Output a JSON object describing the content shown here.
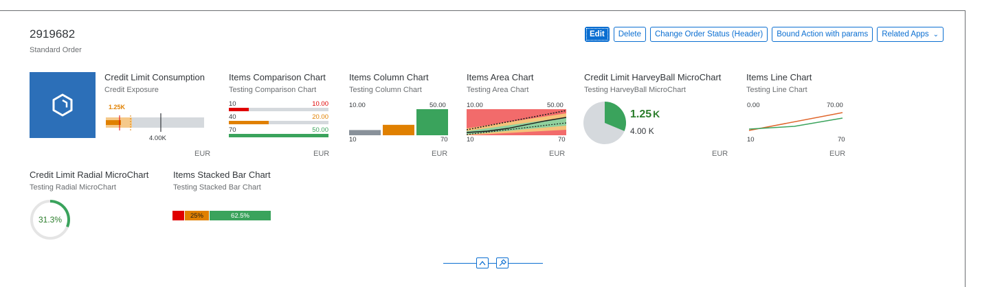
{
  "header": {
    "title": "2919682",
    "subtitle": "Standard Order",
    "actions": {
      "edit": "Edit",
      "delete": "Delete",
      "change_status": "Change Order Status (Header)",
      "bound_action": "Bound Action with params",
      "related_apps": "Related Apps"
    }
  },
  "cards": {
    "credit_limit": {
      "title": "Credit Limit Consumption",
      "subtitle": "Credit Exposure",
      "value_label": "1.25K",
      "target_label": "4.00K",
      "unit": "EUR",
      "chart_data": {
        "type": "bar",
        "actual": 1.25,
        "target": 4.0,
        "max": 10.0
      }
    },
    "comparison": {
      "title": "Items Comparison Chart",
      "subtitle": "Testing Comparison Chart",
      "unit": "EUR",
      "rows": [
        {
          "label": "10",
          "value": "10.00",
          "color": "#e00000",
          "fraction": 0.2
        },
        {
          "label": "40",
          "value": "20.00",
          "color": "#e08000",
          "fraction": 0.4
        },
        {
          "label": "70",
          "value": "50.00",
          "color": "#3aa35c",
          "fraction": 1.0
        }
      ]
    },
    "column": {
      "title": "Items Column Chart",
      "subtitle": "Testing Column Chart",
      "top_left": "10.00",
      "top_right": "50.00",
      "bottom_left": "10",
      "bottom_right": "70",
      "unit": "EUR",
      "chart_data": {
        "type": "bar",
        "values": [
          10,
          20,
          50
        ],
        "colors": [
          "#89919a",
          "#e08000",
          "#3aa35c"
        ]
      }
    },
    "area": {
      "title": "Items Area Chart",
      "subtitle": "Testing Area Chart",
      "top_left": "10.00",
      "top_right": "50.00",
      "bottom_left": "10",
      "bottom_right": "70",
      "unit": "EUR"
    },
    "harvey": {
      "title": "Credit Limit HarveyBall MicroChart",
      "subtitle": "Testing HarveyBall MicroChart",
      "value": "1.25",
      "value_scale": "K",
      "total": "4.00 K",
      "unit": "EUR",
      "chart_data": {
        "type": "pie",
        "fraction": 0.3125
      }
    },
    "line": {
      "title": "Items Line Chart",
      "subtitle": "Testing Line Chart",
      "top_left": "0.00",
      "top_right": "70.00",
      "bottom_left": "10",
      "bottom_right": "70",
      "unit": "EUR"
    },
    "radial": {
      "title": "Credit Limit Radial MicroChart",
      "subtitle": "Testing Radial MicroChart",
      "value": "31.3%",
      "chart_data": {
        "type": "pie",
        "percent": 31.3
      }
    },
    "stacked": {
      "title": "Items Stacked Bar Chart",
      "subtitle": "Testing Stacked Bar Chart",
      "chart_data": {
        "type": "bar",
        "segments": [
          {
            "label": "",
            "percent": 12.5,
            "color": "#e00000"
          },
          {
            "label": "25%",
            "percent": 25,
            "color": "#e08000"
          },
          {
            "label": "62.5%",
            "percent": 62.5,
            "color": "#3aa35c"
          }
        ]
      }
    }
  },
  "colors": {
    "accent": "#0a6ed1",
    "positive": "#3aa35c",
    "critical": "#e08000",
    "negative": "#e00000"
  }
}
